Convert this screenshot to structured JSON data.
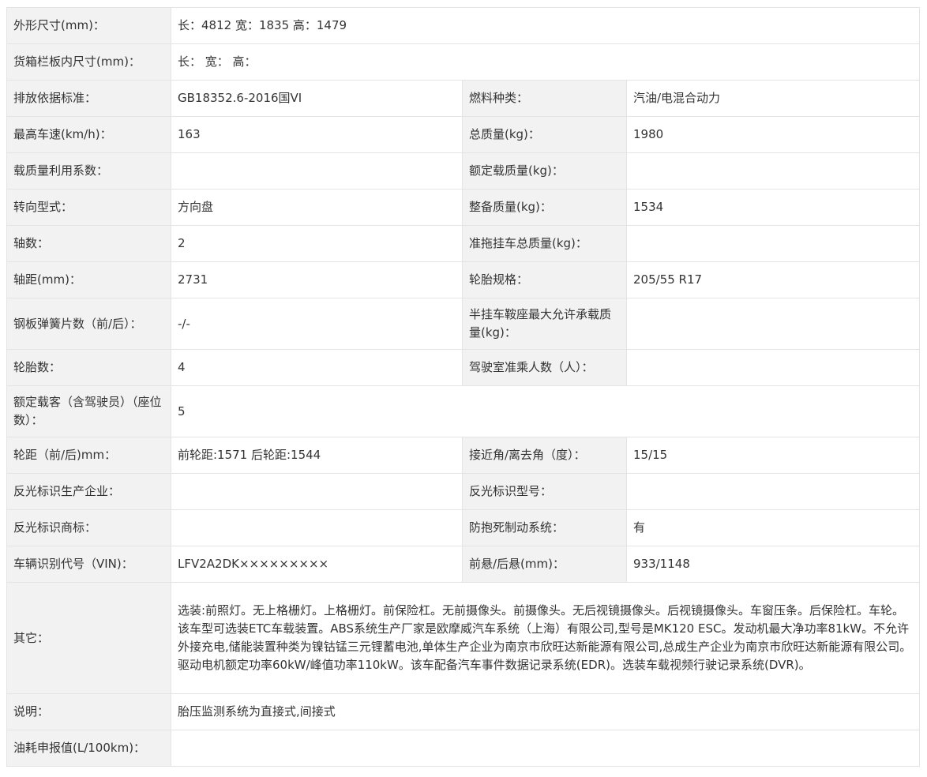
{
  "rows": [
    {
      "cells": [
        {
          "k": "外形尺寸(mm)：",
          "v": "长：4812 宽：1835 高：1479"
        }
      ]
    },
    {
      "cells": [
        {
          "k": "货箱栏板内尺寸(mm)：",
          "v": "长：  宽：  高："
        }
      ]
    },
    {
      "cells": [
        {
          "k": "排放依据标准：",
          "v": "GB18352.6-2016国VI"
        },
        {
          "k": "燃料种类：",
          "v": "汽油/电混合动力"
        }
      ]
    },
    {
      "cells": [
        {
          "k": "最高车速(km/h)：",
          "v": "163"
        },
        {
          "k": "总质量(kg)：",
          "v": "1980"
        }
      ]
    },
    {
      "cells": [
        {
          "k": "载质量利用系数：",
          "v": ""
        },
        {
          "k": "额定载质量(kg)：",
          "v": ""
        }
      ]
    },
    {
      "cells": [
        {
          "k": "转向型式：",
          "v": "方向盘"
        },
        {
          "k": "整备质量(kg)：",
          "v": "1534"
        }
      ]
    },
    {
      "cells": [
        {
          "k": "轴数：",
          "v": "2"
        },
        {
          "k": "准拖挂车总质量(kg)：",
          "v": ""
        }
      ]
    },
    {
      "cells": [
        {
          "k": "轴距(mm)：",
          "v": "2731"
        },
        {
          "k": "轮胎规格：",
          "v": "205/55 R17"
        }
      ]
    },
    {
      "cells": [
        {
          "k": "钢板弹簧片数（前/后）：",
          "v": "-/-"
        },
        {
          "k": "半挂车鞍座最大允许承载质量(kg)：",
          "v": ""
        }
      ]
    },
    {
      "cells": [
        {
          "k": "轮胎数：",
          "v": "4"
        },
        {
          "k": "驾驶室准乘人数（人）：",
          "v": ""
        }
      ]
    },
    {
      "cells": [
        {
          "k": "额定载客（含驾驶员）（座位数）：",
          "v": "5"
        }
      ]
    },
    {
      "cells": [
        {
          "k": "轮距（前/后)mm：",
          "v": "前轮距:1571 后轮距:1544"
        },
        {
          "k": "接近角/离去角（度）：",
          "v": "15/15"
        }
      ]
    },
    {
      "cells": [
        {
          "k": "反光标识生产企业：",
          "v": ""
        },
        {
          "k": "反光标识型号：",
          "v": ""
        }
      ]
    },
    {
      "cells": [
        {
          "k": "反光标识商标：",
          "v": ""
        },
        {
          "k": "防抱死制动系统：",
          "v": "有"
        }
      ]
    },
    {
      "cells": [
        {
          "k": "车辆识别代号（VIN)：",
          "v": "LFV2A2DK×××××××××"
        },
        {
          "k": "前悬/后悬(mm)：",
          "v": "933/1148"
        }
      ]
    },
    {
      "cells": [
        {
          "k": "其它：",
          "v": "选装:前照灯。无上格栅灯。上格栅灯。前保险杠。无前摄像头。前摄像头。无后视镜摄像头。后视镜摄像头。车窗压条。后保险杠。车轮。该车型可选装ETC车载装置。ABS系统生产厂家是欧摩威汽车系统（上海）有限公司,型号是MK120 ESC。发动机最大净功率81kW。不允许外接充电,储能装置种类为镍钴锰三元锂蓄电池,单体生产企业为南京市欣旺达新能源有限公司,总成生产企业为南京市欣旺达新能源有限公司。驱动电机额定功率60kW/峰值功率110kW。该车配备汽车事件数据记录系统(EDR)。选装车载视频行驶记录系统(DVR)。"
        }
      ]
    },
    {
      "cells": [
        {
          "k": "说明：",
          "v": "胎压监测系统为直接式,间接式"
        }
      ]
    },
    {
      "cells": [
        {
          "k": "油耗申报值(L/100km)：",
          "v": ""
        }
      ]
    }
  ]
}
